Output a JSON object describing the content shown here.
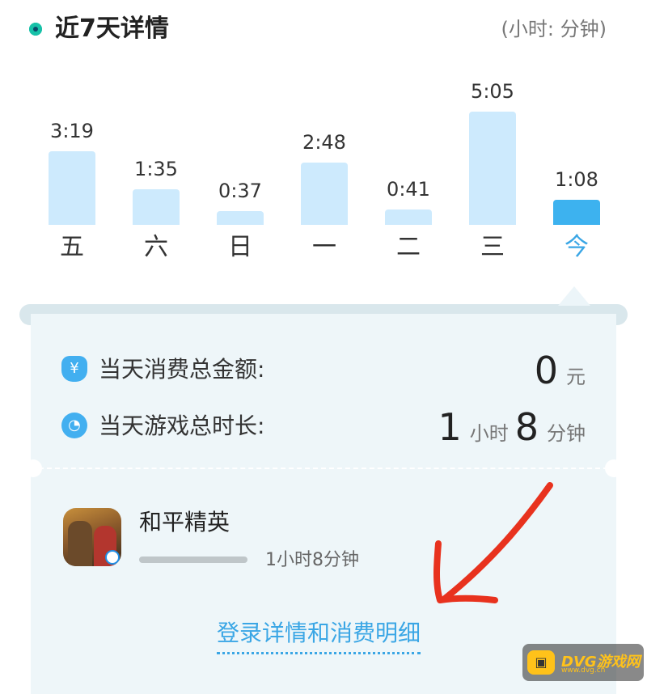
{
  "header": {
    "title": "近7天详情",
    "unit_label": "(小时: 分钟)"
  },
  "chart_data": {
    "type": "bar",
    "categories": [
      "五",
      "六",
      "日",
      "一",
      "二",
      "三",
      "今"
    ],
    "value_labels": [
      "3:19",
      "1:35",
      "0:37",
      "2:48",
      "0:41",
      "5:05",
      "1:08"
    ],
    "values_minutes": [
      199,
      95,
      37,
      168,
      41,
      305,
      68
    ],
    "highlight_index": 6,
    "colors": {
      "bar": "#cdeafd",
      "today": "#3db2ef"
    }
  },
  "summary": {
    "spend_icon": "money-bag-icon",
    "spend_icon_glyph": "¥",
    "spend_label": "当天消费总金额:",
    "spend_value": "0",
    "spend_unit": "元",
    "time_icon": "clock-icon",
    "time_icon_glyph": "◔",
    "time_label": "当天游戏总时长:",
    "time_hours": "1",
    "time_hours_unit": "小时",
    "time_minutes": "8",
    "time_minutes_unit": "分钟"
  },
  "game": {
    "name": "和平精英",
    "playtime": "1小时8分钟",
    "icon": "game-app-icon"
  },
  "detail_link": "登录详情和消费明细",
  "watermark": {
    "glyph": "▣",
    "text": "DVG游戏网",
    "sub": "www.dvg.cn"
  },
  "annotation": {
    "type": "red-arrow",
    "color": "#e8321e"
  }
}
